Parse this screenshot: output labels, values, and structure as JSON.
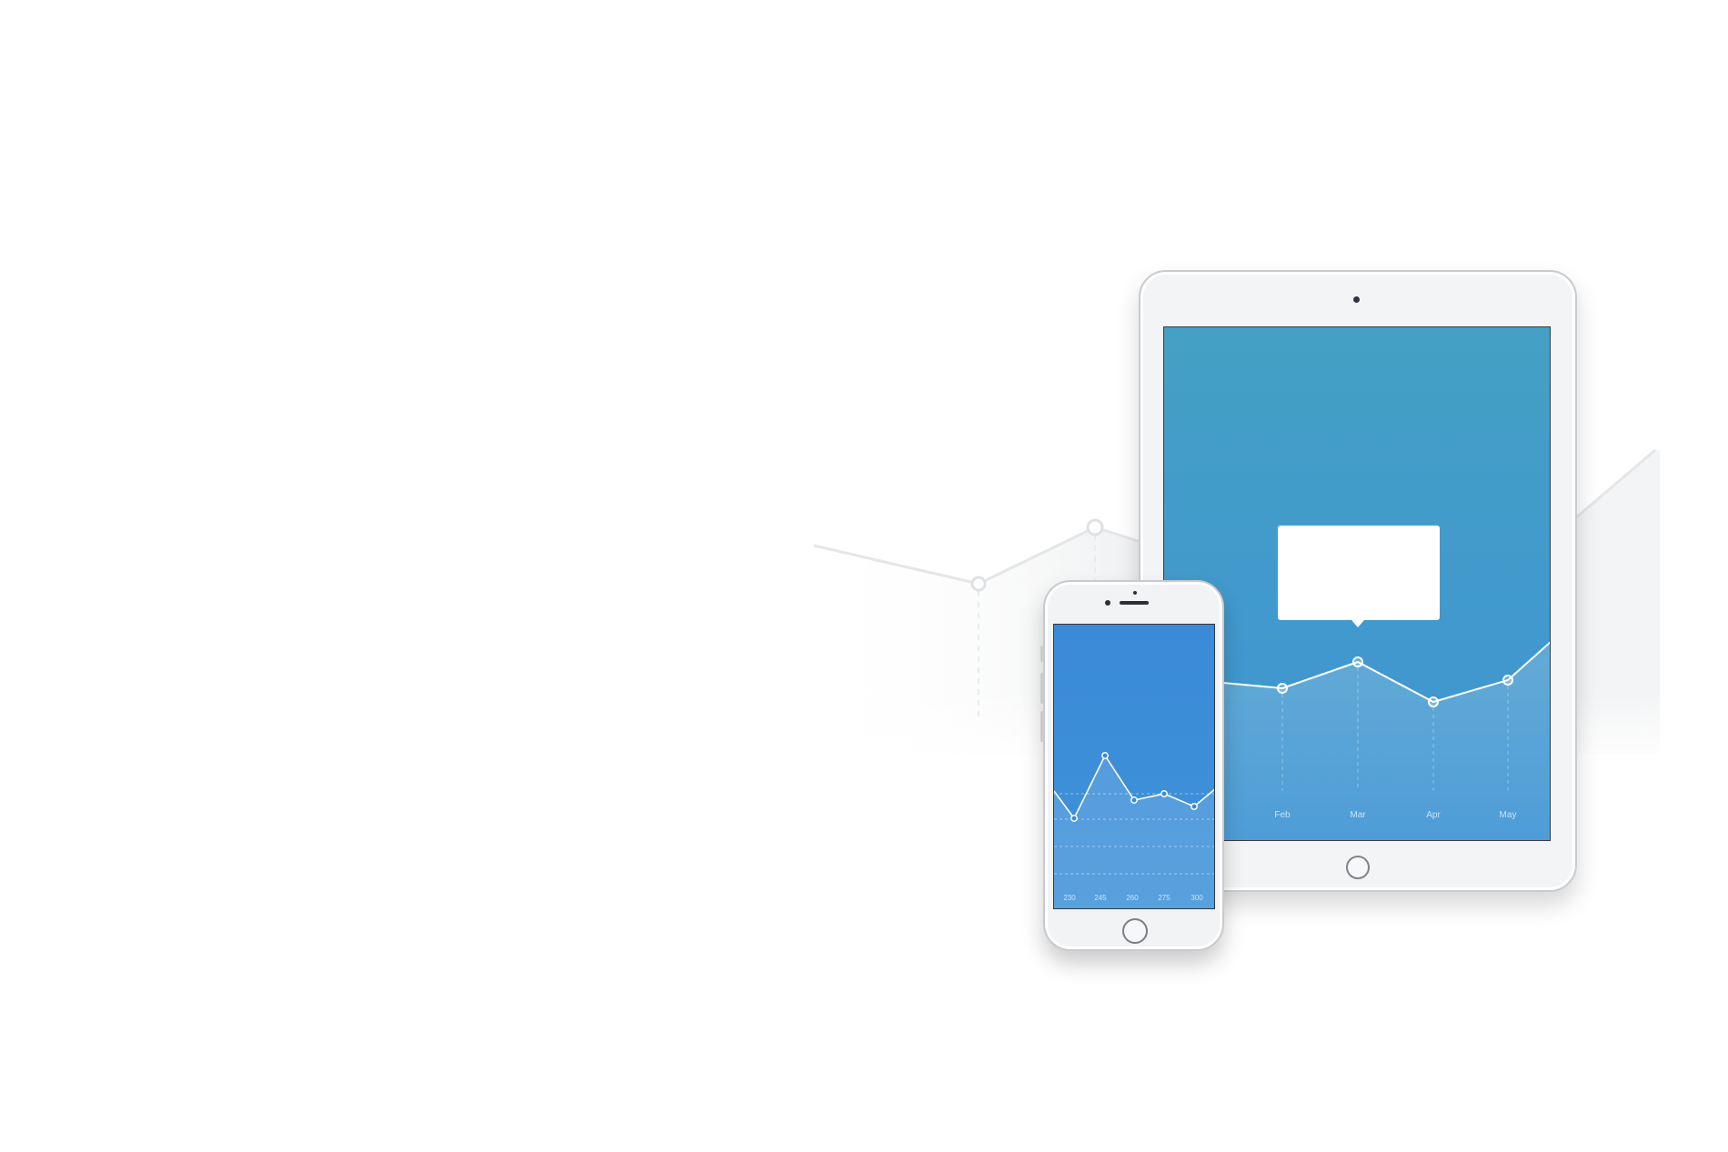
{
  "colors": {
    "tablet_screen_top": "#44a0c4",
    "tablet_screen_bottom": "#3d8fd6",
    "phone_screen_top": "#3a8ad8",
    "phone_screen_bottom": "#4aa2d6",
    "line": "#ffffff",
    "tooltip": "#ffffff",
    "background_line": "#e6e8ea"
  },
  "tablet": {
    "x_labels": [
      "Feb",
      "Mar",
      "Apr",
      "May"
    ]
  },
  "phone": {
    "x_labels": [
      "230",
      "245",
      "260",
      "275",
      "300"
    ]
  }
}
